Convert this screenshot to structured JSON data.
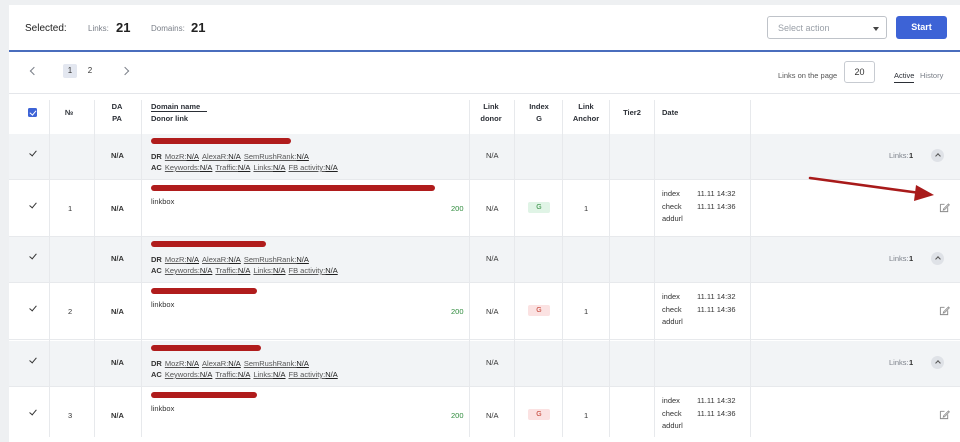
{
  "toolbar": {
    "selected_label": "Selected:",
    "links_label": "Links:",
    "links_count": "21",
    "domains_label": "Domains:",
    "domains_count": "21",
    "action_placeholder": "Select action",
    "start_label": "Start"
  },
  "pager": {
    "pages": [
      "1",
      "2"
    ],
    "current_page": "1",
    "links_on_page_label": "Links on the page",
    "links_on_page_value": "20",
    "tabs": [
      "Active",
      "History"
    ],
    "active_tab": "Active"
  },
  "table": {
    "headers": {
      "num": "№",
      "da": "DA",
      "pa": "PA",
      "domain_name": "Domain name",
      "donor_link": "Donor link",
      "link_donor_1": "Link",
      "link_donor_2": "donor",
      "index_g_1": "Index",
      "index_g_2": "G",
      "link_anchor_1": "Link",
      "link_anchor_2": "Anchor",
      "tier2": "Tier2",
      "date": "Date"
    },
    "meta_labels": {
      "dr": "DR",
      "ac": "AC",
      "moz": "MozR:",
      "alexa": "AlexaR:",
      "semrush": "SemRushRank:",
      "keywords": "Keywords:",
      "traffic": "Traffic:",
      "links": "Links:",
      "fb": "FB activity:"
    },
    "groups": [
      {
        "domain": {
          "da_pa": "N/A",
          "moz": "N/A",
          "alexa": "N/A",
          "semrush": "N/A",
          "keywords": "N/A",
          "traffic": "N/A",
          "links": "N/A",
          "fb": "N/A",
          "link_donor": "N/A",
          "links_label": "Links:",
          "links_count": "1"
        },
        "link": {
          "num": "1",
          "da_pa": "N/A",
          "anchor_text": "linkbox",
          "score": "200",
          "link_donor": "N/A",
          "index_g": "G",
          "index_status": "indexed",
          "link_anchor": "1",
          "date_labels": [
            "index",
            "check",
            "addurl"
          ],
          "date_values": [
            "11.11 14:32",
            "11.11 14:36",
            ""
          ]
        }
      },
      {
        "domain": {
          "da_pa": "N/A",
          "moz": "N/A",
          "alexa": "N/A",
          "semrush": "N/A",
          "keywords": "N/A",
          "traffic": "N/A",
          "links": "N/A",
          "fb": "N/A",
          "link_donor": "N/A",
          "links_label": "Links:",
          "links_count": "1"
        },
        "link": {
          "num": "2",
          "da_pa": "N/A",
          "anchor_text": "linkbox",
          "score": "200",
          "link_donor": "N/A",
          "index_g": "G",
          "index_status": "not-indexed",
          "link_anchor": "1",
          "date_labels": [
            "index",
            "check",
            "addurl"
          ],
          "date_values": [
            "11.11 14:32",
            "11.11 14:36",
            ""
          ]
        }
      },
      {
        "domain": {
          "da_pa": "N/A",
          "moz": "N/A",
          "alexa": "N/A",
          "semrush": "N/A",
          "keywords": "N/A",
          "traffic": "N/A",
          "links": "N/A",
          "fb": "N/A",
          "link_donor": "N/A",
          "links_label": "Links:",
          "links_count": "1"
        },
        "link": {
          "num": "3",
          "da_pa": "N/A",
          "anchor_text": "linkbox",
          "score": "200",
          "link_donor": "N/A",
          "index_g": "G",
          "index_status": "not-indexed",
          "link_anchor": "1",
          "date_labels": [
            "index",
            "check",
            "addurl"
          ],
          "date_values": [
            "11.11 14:32",
            "11.11 14:36",
            ""
          ]
        }
      }
    ]
  },
  "colors": {
    "accent": "#3d63d6",
    "redaction": "#b01c1c",
    "indexed_bg": "#e0f4e6",
    "not_indexed_bg": "#fbe2e2"
  },
  "icons": [
    "chevron-left-icon",
    "chevron-right-icon",
    "caret-down-icon",
    "checkbox-icon",
    "chevron-up-icon",
    "edit-icon",
    "arrow-annotation"
  ]
}
